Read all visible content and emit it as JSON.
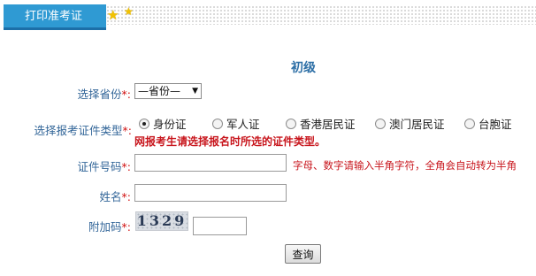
{
  "header": {
    "tab_label": "打印准考证"
  },
  "form": {
    "title": "初级",
    "province": {
      "label": "选择省份",
      "required_mark": "*:",
      "selected": "—省份—"
    },
    "cert_type": {
      "label": "选择报考证件类型",
      "required_mark": "*:",
      "options": [
        {
          "label": "身份证",
          "checked": true
        },
        {
          "label": "军人证",
          "checked": false
        },
        {
          "label": "香港居民证",
          "checked": false
        },
        {
          "label": "澳门居民证",
          "checked": false
        },
        {
          "label": "台胞证",
          "checked": false
        }
      ],
      "warning": "网报考生请选择报名时所选的证件类型。"
    },
    "id_number": {
      "label": "证件号码",
      "required_mark": "*:",
      "value": "",
      "hint": "字母、数字请输入半角字符，全角会自动转为半角"
    },
    "name": {
      "label": "姓名",
      "required_mark": "*:",
      "value": ""
    },
    "captcha": {
      "label": "附加码",
      "required_mark": "*:",
      "image_text": "1329",
      "value": ""
    },
    "submit_label": "查询"
  },
  "colors": {
    "tab_bg": "#2f9ad3",
    "label": "#336699",
    "warning": "#c8161d",
    "title": "#2d6fa6"
  }
}
